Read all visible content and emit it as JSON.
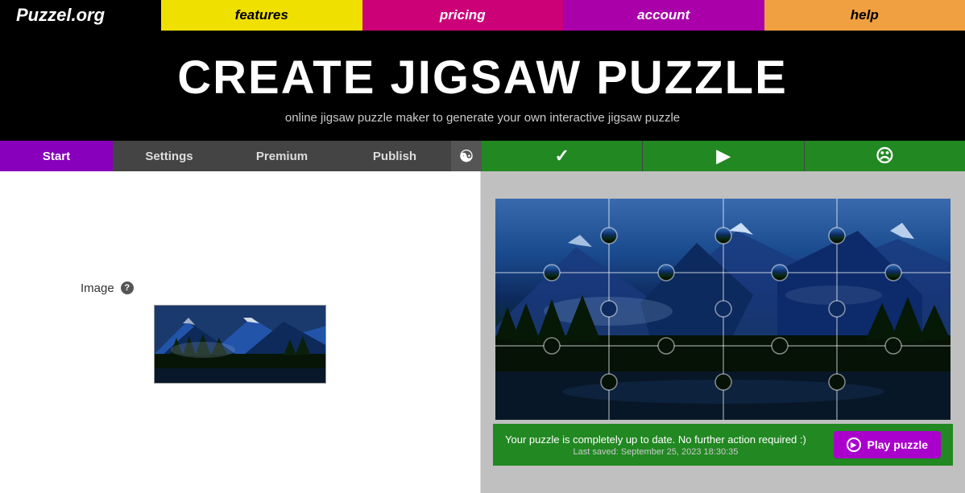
{
  "header": {
    "logo": "Puzzel.org",
    "nav": [
      {
        "label": "features",
        "class": "nav-features"
      },
      {
        "label": "pricing",
        "class": "nav-pricing"
      },
      {
        "label": "account",
        "class": "nav-account"
      },
      {
        "label": "help",
        "class": "nav-help"
      }
    ]
  },
  "hero": {
    "title": "CREATE JIGSAW PUZZLE",
    "subtitle": "online jigsaw puzzle maker to generate your own interactive jigsaw puzzle"
  },
  "tabs": {
    "start": "Start",
    "settings": "Settings",
    "premium": "Premium",
    "publish": "Publish"
  },
  "left_panel": {
    "image_label": "Image",
    "help_tooltip": "?"
  },
  "status_bar": {
    "main_text": "Your puzzle is completely up to date. No further action required :)",
    "saved_text": "Last saved: September 25, 2023 18:30:35",
    "play_button": "Play puzzle"
  }
}
